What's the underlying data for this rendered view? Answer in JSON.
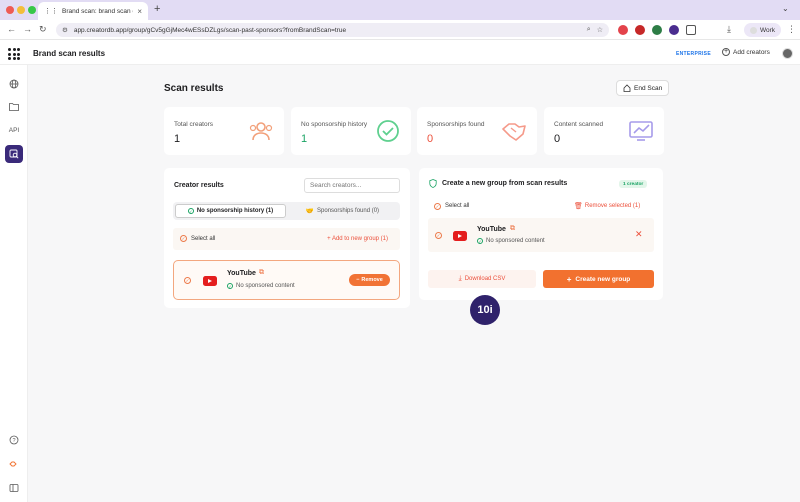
{
  "browser": {
    "tab_title": "Brand scan: brand scan draft",
    "url": "app.creatordb.app/group/gCv5gGjMec4wESsDZLgs/scan-past-sponsors?fromBrandScan=true",
    "profile_label": "Work"
  },
  "app": {
    "title": "Brand scan results",
    "plan_badge": "ENTERPRISE",
    "add_creators_label": "Add creators",
    "rail_api_label": "API"
  },
  "page": {
    "title": "Scan results",
    "end_scan_label": "End Scan"
  },
  "stats": [
    {
      "label": "Total creators",
      "value": "1"
    },
    {
      "label": "No sponsorship history",
      "value": "1"
    },
    {
      "label": "Sponsorships found",
      "value": "0"
    },
    {
      "label": "Content scanned",
      "value": "0"
    }
  ],
  "creator_results": {
    "title": "Creator results",
    "search_placeholder": "Search creators...",
    "tabs": [
      {
        "label": "No sponsorship history (1)",
        "selected": true
      },
      {
        "label": "Sponsorships found (0)",
        "selected": false
      }
    ],
    "select_all_label": "Select all",
    "add_to_group_label": "+ Add to new group (1)",
    "card": {
      "name": "YouTube",
      "status": "No sponsored content",
      "remove_label": "Remove"
    }
  },
  "new_group": {
    "title": "Create a new group from scan results",
    "count_badge": "1 creator",
    "select_all_label": "Select all",
    "remove_selected_label": "Remove selected (1)",
    "card": {
      "name": "YouTube",
      "status": "No sponsored content"
    },
    "download_csv_label": "Download CSV",
    "create_group_label": "Create new group"
  },
  "annotation": {
    "step_label": "10i"
  },
  "colors": {
    "accent": "#f2712f",
    "danger": "#ec4f3a",
    "success": "#1aa364",
    "rail_active": "#3a2a7a",
    "badge": "#2f226b"
  }
}
